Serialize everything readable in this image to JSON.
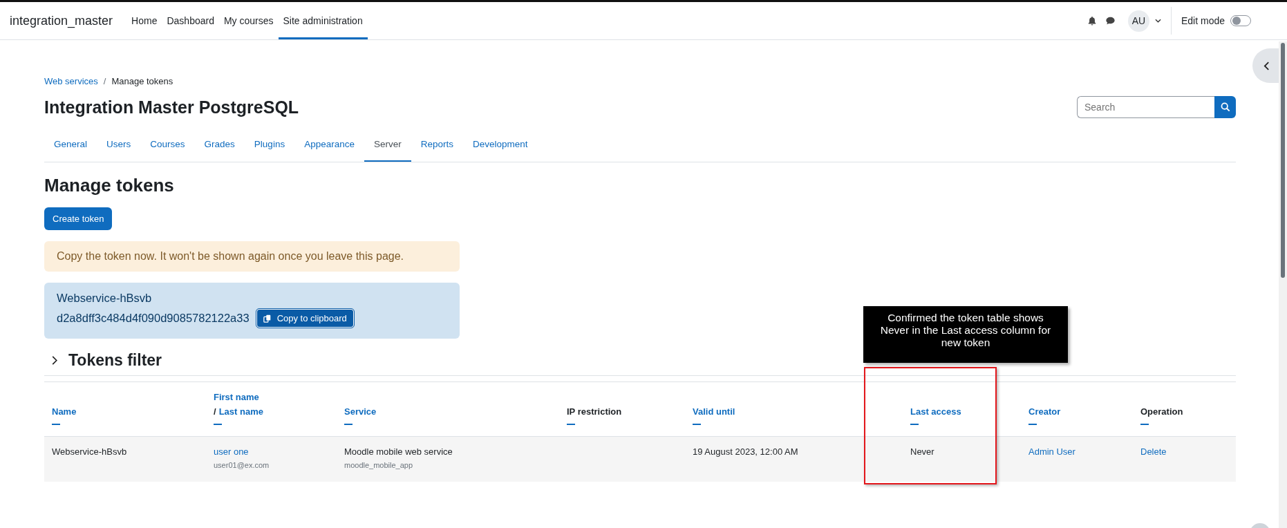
{
  "navbar": {
    "site_name": "integration_master",
    "items": [
      {
        "label": "Home",
        "selected": false
      },
      {
        "label": "Dashboard",
        "selected": false
      },
      {
        "label": "My courses",
        "selected": false
      },
      {
        "label": "Site administration",
        "selected": true
      }
    ],
    "avatar": "AU",
    "edit_mode": {
      "label": "Edit mode",
      "on": false
    }
  },
  "breadcrumb": {
    "separator": "/",
    "items": [
      {
        "label": "Web services",
        "link": true
      },
      {
        "label": "Manage tokens",
        "link": false
      }
    ]
  },
  "page_title": "Integration Master PostgreSQL",
  "search": {
    "placeholder": "Search"
  },
  "tabs": [
    {
      "label": "General",
      "selected": false
    },
    {
      "label": "Users",
      "selected": false
    },
    {
      "label": "Courses",
      "selected": false
    },
    {
      "label": "Grades",
      "selected": false
    },
    {
      "label": "Plugins",
      "selected": false
    },
    {
      "label": "Appearance",
      "selected": false
    },
    {
      "label": "Server",
      "selected": true
    },
    {
      "label": "Reports",
      "selected": false
    },
    {
      "label": "Development",
      "selected": false
    }
  ],
  "heading": "Manage tokens",
  "create_button": "Create token",
  "warning": "Copy the token now. It won't be shown again once you leave this page.",
  "token_box": {
    "name": "Webservice-hBsvb",
    "token": "d2a8dff3c484d4f090d9085782122a33",
    "copy_button": "Copy to clipboard"
  },
  "filter": {
    "label": "Tokens filter",
    "expanded": false
  },
  "table": {
    "columns": [
      {
        "label": "Name",
        "sortable": true
      },
      {
        "label": "First name",
        "separator": "/",
        "label_2": "Last name",
        "sortable": true
      },
      {
        "label": "Service",
        "sortable": true
      },
      {
        "label": "IP restriction",
        "sortable": false
      },
      {
        "label": "Valid until",
        "sortable": true
      },
      {
        "label": "Last access",
        "sortable": true
      },
      {
        "label": "Creator",
        "sortable": true
      },
      {
        "label": "Operation",
        "sortable": false
      }
    ],
    "rows": [
      {
        "cells": [
          {
            "kind": "text",
            "text": "Webservice-hBsvb"
          },
          {
            "kind": "user",
            "text": "user one",
            "sub": "user01@ex.com"
          },
          {
            "kind": "service",
            "text": "Moodle mobile web service",
            "sub": "moodle_mobile_app"
          },
          {
            "kind": "empty"
          },
          {
            "kind": "text",
            "text": "19 August 2023, 12:00 AM"
          },
          {
            "kind": "text",
            "text": "Never"
          },
          {
            "kind": "link",
            "text": "Admin User"
          },
          {
            "kind": "link",
            "text": "Delete"
          }
        ]
      }
    ]
  },
  "annotation": {
    "text": "Confirmed the token table shows Never in the Last access column for new token"
  }
}
